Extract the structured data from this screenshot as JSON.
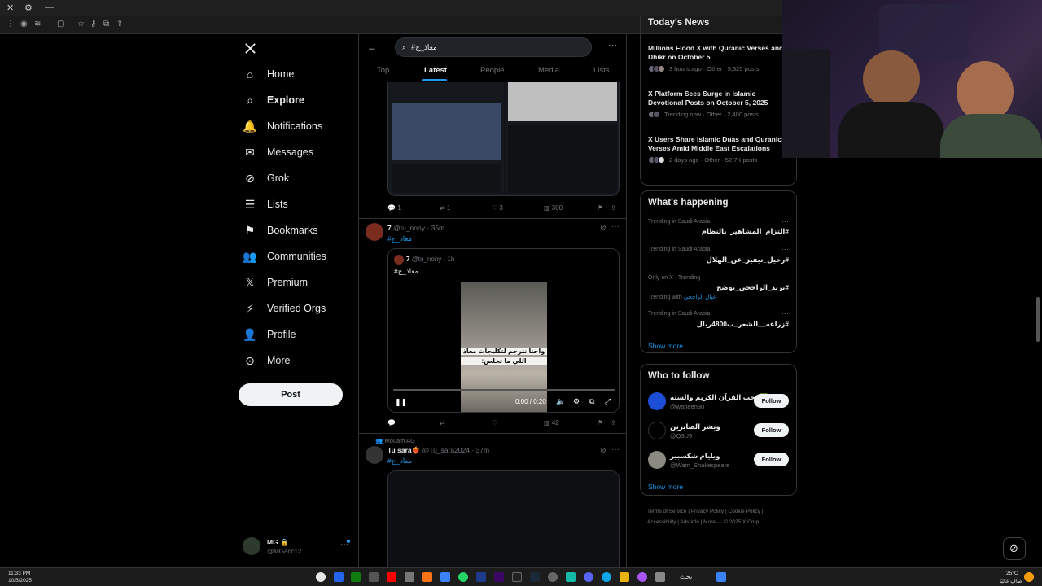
{
  "nav": {
    "items": [
      {
        "label": "Home",
        "icon": "home-icon"
      },
      {
        "label": "Explore",
        "icon": "search-icon"
      },
      {
        "label": "Notifications",
        "icon": "bell-icon"
      },
      {
        "label": "Messages",
        "icon": "envelope-icon"
      },
      {
        "label": "Grok",
        "icon": "grok-icon"
      },
      {
        "label": "Lists",
        "icon": "list-icon"
      },
      {
        "label": "Bookmarks",
        "icon": "bookmark-icon"
      },
      {
        "label": "Communities",
        "icon": "people-icon"
      },
      {
        "label": "Premium",
        "icon": "x-logo-icon"
      },
      {
        "label": "Verified Orgs",
        "icon": "lightning-icon"
      },
      {
        "label": "Profile",
        "icon": "person-icon"
      },
      {
        "label": "More",
        "icon": "more-circle-icon"
      }
    ],
    "post_label": "Post",
    "account": {
      "name": "MG 🔒",
      "handle": "@MGacc12"
    }
  },
  "search": {
    "value": "#معاذ_ج"
  },
  "tabs": [
    "Top",
    "Latest",
    "People",
    "Media",
    "Lists"
  ],
  "tweet1": {
    "replies": "1",
    "retweets": "1",
    "likes": "3",
    "views": "300"
  },
  "tweet2": {
    "name": "7",
    "handle": "@tu_nony",
    "time": "35m",
    "text": "#معاذ_ج",
    "quote": {
      "name": "7",
      "handle": "@tu_nony",
      "time": "1h",
      "text": "#معاذ_ج"
    },
    "video_caption_1": "واحنا نترجم لتكليجات معاذ",
    "video_caption_2": "اللي ما تخلص:",
    "video_time": "0:00 / 0:20",
    "views": "42"
  },
  "tweet3": {
    "context": "Mouath AG",
    "name": "Tu sara❤️‍🔥",
    "handle": "@Tu_sara2024",
    "time": "37m",
    "text": "#معاذ_ج"
  },
  "news": {
    "title": "Today's News",
    "items": [
      {
        "title": "Millions Flood X with Quranic Verses and Dhikr on October 5",
        "meta": "3 hours ago · Other · 5,325 posts"
      },
      {
        "title": "X Platform Sees Surge in Islamic Devotional Posts on October 5, 2025",
        "meta": "Trending now · Other · 2,400 posts"
      },
      {
        "title": "X Users Share Islamic Duas and Quranic Verses Amid Middle East Escalations",
        "meta": "2 days ago · Other · 52.7K posts"
      }
    ]
  },
  "happening": {
    "title": "What's happening",
    "items": [
      {
        "context": "Trending in Saudi Arabia",
        "topic": "#التزام_المشاهير_بالنظام"
      },
      {
        "context": "Trending in Saudi Arabia",
        "topic": "#رحيل_نيفيز_عن_الهلال"
      },
      {
        "context": "Only on X · Trending",
        "topic": "#بريد_الراجحي_يوضح",
        "with": "Trending with",
        "with_link": "عيال الراجحي"
      },
      {
        "context": "Trending in Saudi Arabia",
        "topic": "#زراعه__الشعر_ب4800ريال"
      }
    ],
    "show_more": "Show more"
  },
  "who_to_follow": {
    "title": "Who to follow",
    "items": [
      {
        "name": "محب القرآن الكريم والسنه🟩",
        "handle": "@waheen30",
        "follow": "Follow"
      },
      {
        "name": "ويشر الصابرين",
        "handle": "@Q3U9",
        "follow": "Follow"
      },
      {
        "name": "ويليام شكسبير",
        "handle": "@Wam_Shakespeare",
        "follow": "Follow"
      }
    ],
    "show_more": "Show more"
  },
  "footer": {
    "links": [
      "Terms of Service",
      "Privacy Policy",
      "Cookie Policy",
      "Accessibility",
      "Ads info",
      "More ···",
      "© 2025 X Corp."
    ]
  },
  "taskbar": {
    "time": "11:33 PM",
    "date": "10/5/2025",
    "search": "بحث",
    "weather": "25°C",
    "weather_text": "صافٍ غالبًا"
  },
  "colors": {
    "accent": "#1d9bf0",
    "like": "#f91880",
    "bg": "#000000",
    "border": "#2f3336"
  }
}
